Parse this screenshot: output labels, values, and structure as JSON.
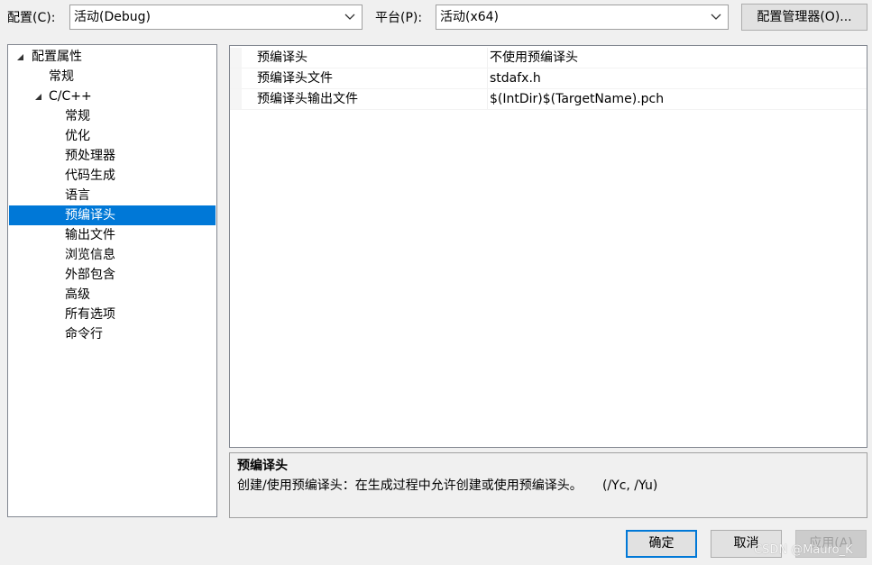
{
  "header": {
    "config_label": "配置(C):",
    "config_value": "活动(Debug)",
    "platform_label": "平台(P):",
    "platform_value": "活动(x64)",
    "config_manager_button": "配置管理器(O)..."
  },
  "tree": {
    "items": [
      {
        "label": "配置属性",
        "level": 0,
        "expanded": true,
        "selected": false
      },
      {
        "label": "常规",
        "level": 1,
        "selected": false
      },
      {
        "label": "C/C++",
        "level": 1,
        "expanded": true,
        "selected": false
      },
      {
        "label": "常规",
        "level": 2,
        "selected": false
      },
      {
        "label": "优化",
        "level": 2,
        "selected": false
      },
      {
        "label": "预处理器",
        "level": 2,
        "selected": false
      },
      {
        "label": "代码生成",
        "level": 2,
        "selected": false
      },
      {
        "label": "语言",
        "level": 2,
        "selected": false
      },
      {
        "label": "预编译头",
        "level": 2,
        "selected": true
      },
      {
        "label": "输出文件",
        "level": 2,
        "selected": false
      },
      {
        "label": "浏览信息",
        "level": 2,
        "selected": false
      },
      {
        "label": "外部包含",
        "level": 2,
        "selected": false
      },
      {
        "label": "高级",
        "level": 2,
        "selected": false
      },
      {
        "label": "所有选项",
        "level": 2,
        "selected": false
      },
      {
        "label": "命令行",
        "level": 2,
        "selected": false
      }
    ]
  },
  "properties": {
    "rows": [
      {
        "name": "预编译头",
        "value": "不使用预编译头"
      },
      {
        "name": "预编译头文件",
        "value": "stdafx.h"
      },
      {
        "name": "预编译头输出文件",
        "value": "$(IntDir)$(TargetName).pch"
      }
    ]
  },
  "description": {
    "title": "预编译头",
    "text": "创建/使用预编译头：在生成过程中允许创建或使用预编译头。     (/Yc, /Yu)"
  },
  "footer": {
    "ok": "确定",
    "cancel": "取消",
    "apply": "应用(A)"
  },
  "watermark": "CSDN @Mauro_K",
  "colors": {
    "selection": "#0078d7",
    "default_button_border": "#0078d7"
  }
}
